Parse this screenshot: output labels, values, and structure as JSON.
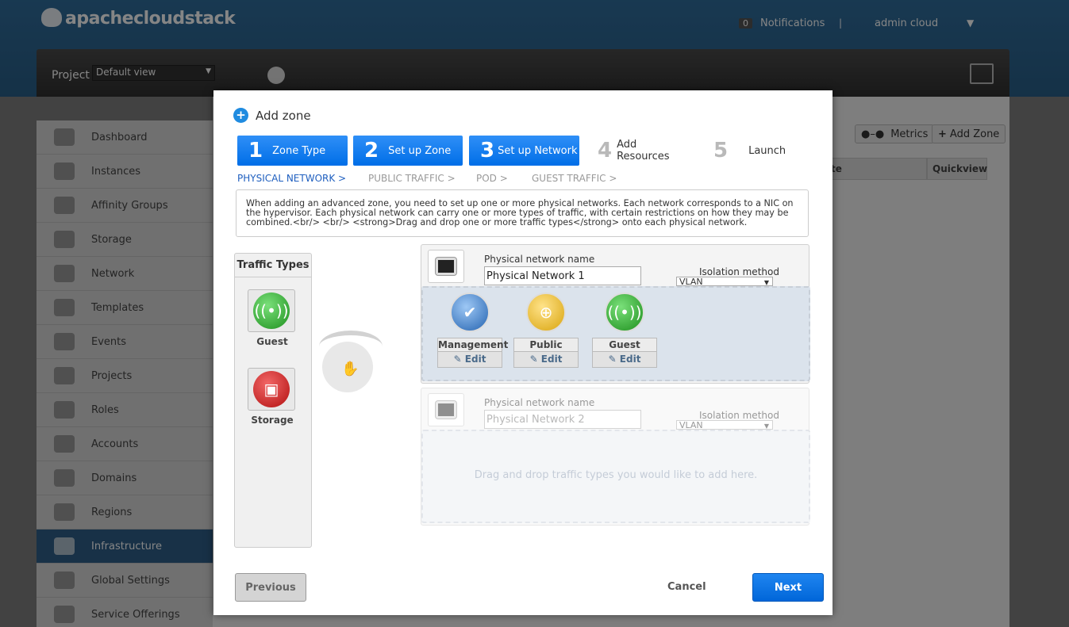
{
  "app": {
    "brand": "apachecloudstack"
  },
  "header": {
    "notifications_count": "0",
    "notifications_label": "Notifications",
    "separator": "|",
    "user": "admin cloud",
    "user_caret": "▼"
  },
  "projectbar": {
    "label": "Project",
    "selected": "Default view",
    "caret": "▼"
  },
  "sidebar": {
    "items": [
      {
        "label": "Dashboard"
      },
      {
        "label": "Instances"
      },
      {
        "label": "Affinity Groups"
      },
      {
        "label": "Storage"
      },
      {
        "label": "Network"
      },
      {
        "label": "Templates"
      },
      {
        "label": "Events"
      },
      {
        "label": "Projects"
      },
      {
        "label": "Roles"
      },
      {
        "label": "Accounts"
      },
      {
        "label": "Domains"
      },
      {
        "label": "Regions"
      },
      {
        "label": "Infrastructure"
      },
      {
        "label": "Global Settings"
      },
      {
        "label": "Service Offerings"
      }
    ],
    "active": "Infrastructure"
  },
  "toolbar": {
    "metrics": "Metrics",
    "add_zone": "Add Zone"
  },
  "table": {
    "headers": [
      "te",
      "Quickview"
    ]
  },
  "dialog": {
    "title": "Add zone",
    "steps": [
      {
        "num": "1",
        "label": "Zone Type",
        "state": "done"
      },
      {
        "num": "2",
        "label": "Set up Zone",
        "state": "done"
      },
      {
        "num": "3",
        "label": "Set up Network",
        "state": "done"
      },
      {
        "num": "4",
        "label": "Add Resources",
        "state": "todo"
      },
      {
        "num": "5",
        "label": "Launch",
        "state": "todo"
      }
    ],
    "substeps": [
      "PHYSICAL NETWORK >",
      "PUBLIC TRAFFIC >",
      "POD >",
      "GUEST TRAFFIC >"
    ],
    "info": "When adding an advanced zone, you need to set up one or more physical networks. Each network corresponds to a NIC on the hypervisor. Each physical network can carry one or more types of traffic, with certain restrictions on how they may be combined.<br/> <br/> <strong>Drag and drop one or more traffic types</strong> onto each physical network.",
    "traffic_types": {
      "title": "Traffic Types",
      "items": [
        {
          "label": "Guest"
        },
        {
          "label": "Storage"
        }
      ]
    },
    "networks": [
      {
        "name_label": "Physical network name",
        "name_value": "Physical Network 1",
        "isolation_label": "Isolation method",
        "isolation_value": "VLAN",
        "traffic": [
          {
            "name": "Management",
            "edit": "Edit"
          },
          {
            "name": "Public",
            "edit": "Edit"
          },
          {
            "name": "Guest",
            "edit": "Edit"
          }
        ]
      },
      {
        "name_label": "Physical network name",
        "name_placeholder": "Physical Network 2",
        "isolation_label": "Isolation method",
        "isolation_value": "VLAN",
        "drop_hint": "Drag and drop traffic types you would like to add here."
      }
    ],
    "buttons": {
      "previous": "Previous",
      "cancel": "Cancel",
      "next": "Next"
    }
  },
  "colors": {
    "header": "#2f6d9c",
    "active_nav": "#2e5f88",
    "primary_button": "#0a73e6",
    "step_done": "#1a80f0"
  }
}
